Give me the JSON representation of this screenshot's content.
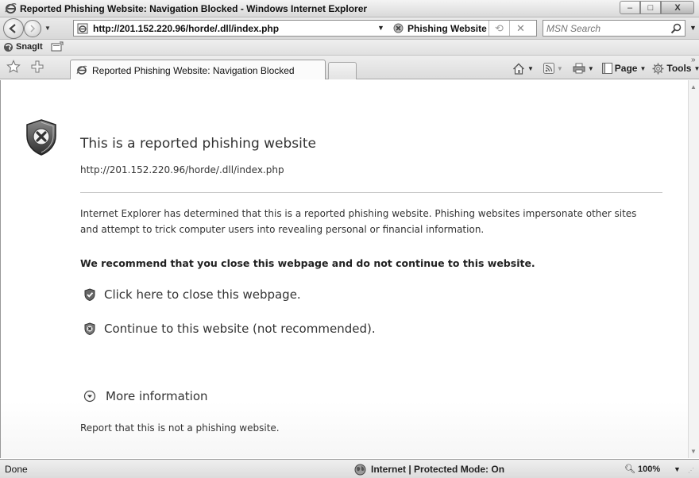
{
  "window": {
    "title": "Reported Phishing Website: Navigation Blocked - Windows Internet Explorer",
    "minimize": "–",
    "maximize": "□",
    "close": "X"
  },
  "address_bar": {
    "url": "http://201.152.220.96/horde/.dll/index.php",
    "security_label": "Phishing Website",
    "search_placeholder": "MSN Search"
  },
  "links_bar": {
    "snagit_label": "SnagIt"
  },
  "tabs": [
    {
      "label": "Reported Phishing Website: Navigation Blocked"
    }
  ],
  "command_bar": {
    "page_label": "Page",
    "tools_label": "Tools"
  },
  "content": {
    "heading": "This is a reported phishing website",
    "url": "http://201.152.220.96/horde/.dll/index.php",
    "description": "Internet Explorer has determined that this is a reported phishing website. Phishing websites impersonate other sites and attempt to trick computer users into revealing personal or financial information.",
    "recommendation": "We recommend that you close this webpage and do not continue to this website.",
    "close_link": "Click here to close this webpage.",
    "continue_link": "Continue to this website (not recommended).",
    "more_info": "More information",
    "report_link": "Report that this is not a phishing website."
  },
  "status_bar": {
    "status": "Done",
    "zone": "Internet | Protected Mode: On",
    "zoom": "100%"
  },
  "colors": {
    "shield_dark": "#3d3d3d",
    "shield_light": "#8a8a8a",
    "chrome_gradient_top": "#efefef",
    "chrome_gradient_bottom": "#d8d8d8"
  }
}
